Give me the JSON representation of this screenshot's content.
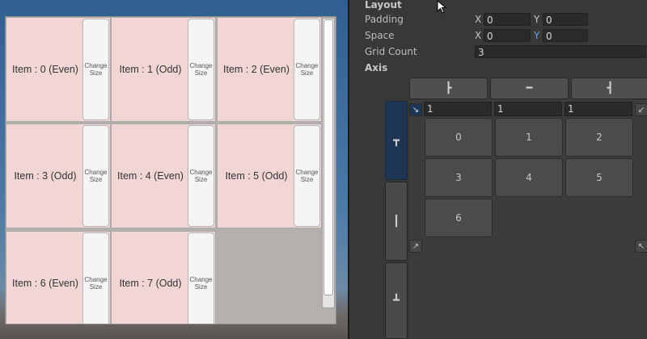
{
  "scene": {
    "cells": [
      {
        "label": "Item : 0 (Even)",
        "button": [
          "Change",
          "Size"
        ]
      },
      {
        "label": "Item : 1 (Odd)",
        "button": [
          "Change",
          "Size"
        ]
      },
      {
        "label": "Item : 2 (Even)",
        "button": [
          "Change",
          "Size"
        ]
      },
      {
        "label": "Item : 3 (Odd)",
        "button": [
          "Change",
          "Size"
        ]
      },
      {
        "label": "Item : 4 (Even)",
        "button": [
          "Change",
          "Size"
        ]
      },
      {
        "label": "Item : 5 (Odd)",
        "button": [
          "Change",
          "Size"
        ]
      },
      {
        "label": "Item : 6 (Even)",
        "button": [
          "Change",
          "Size"
        ]
      },
      {
        "label": "Item : 7 (Odd)",
        "button": [
          "Change",
          "Size"
        ]
      }
    ]
  },
  "inspector": {
    "layout_title": "Layout",
    "padding": {
      "label": "Padding",
      "x_label": "X",
      "x": "0",
      "y_label": "Y",
      "y": "0"
    },
    "space": {
      "label": "Space",
      "x_label": "X",
      "x": "0",
      "y_label": "Y",
      "y": "0"
    },
    "grid_count": {
      "label": "Grid Count",
      "value": "3"
    },
    "axis_title": "Axis",
    "align_buttons": [
      {
        "icon": "align-left-icon",
        "glyph": "┣"
      },
      {
        "icon": "align-center-icon",
        "glyph": "━"
      },
      {
        "icon": "align-right-icon",
        "glyph": "┫"
      }
    ],
    "vertical_tabs": [
      {
        "icon": "align-top-icon",
        "glyph": "┳",
        "active": true
      },
      {
        "icon": "align-middle-icon",
        "glyph": "┃",
        "active": false
      },
      {
        "icon": "align-bottom-icon",
        "glyph": "┻",
        "active": false
      }
    ],
    "column_fields": [
      "1",
      "1",
      "1"
    ],
    "grid_cells": [
      "0",
      "1",
      "2",
      "3",
      "4",
      "5",
      "6"
    ],
    "corners": {
      "top_left": "↘",
      "top_right": "↙",
      "bottom_left": "↗",
      "bottom_right": "↖"
    },
    "colors": {
      "active_blue": "#1e3654",
      "cell_pink": "#f2d6d6"
    }
  }
}
